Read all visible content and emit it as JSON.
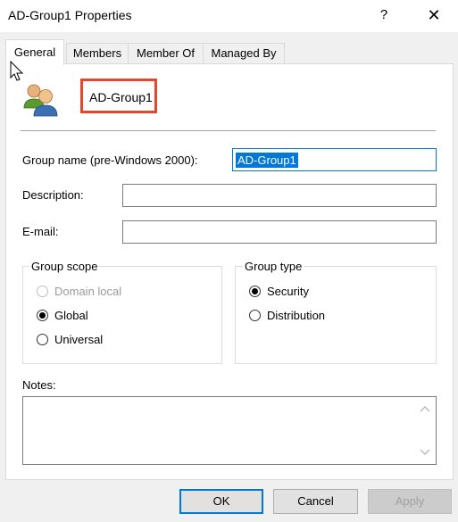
{
  "window": {
    "title": "AD-Group1 Properties",
    "help_glyph": "?",
    "close_glyph": "✕"
  },
  "tabs": [
    {
      "label": "General",
      "active": true
    },
    {
      "label": "Members",
      "active": false
    },
    {
      "label": "Member Of",
      "active": false
    },
    {
      "label": "Managed By",
      "active": false
    }
  ],
  "general": {
    "group_name": "AD-Group1",
    "pre2000_label": "Group name (pre-Windows 2000):",
    "pre2000_value": "AD-Group1",
    "description_label": "Description:",
    "description_value": "",
    "email_label": "E-mail:",
    "email_value": "",
    "group_scope": {
      "legend": "Group scope",
      "options": [
        {
          "label": "Domain local",
          "selected": false,
          "enabled": false
        },
        {
          "label": "Global",
          "selected": true,
          "enabled": true
        },
        {
          "label": "Universal",
          "selected": false,
          "enabled": true
        }
      ]
    },
    "group_type": {
      "legend": "Group type",
      "options": [
        {
          "label": "Security",
          "selected": true,
          "enabled": true
        },
        {
          "label": "Distribution",
          "selected": false,
          "enabled": true
        }
      ]
    },
    "notes_label": "Notes:",
    "notes_value": ""
  },
  "buttons": {
    "ok": "OK",
    "cancel": "Cancel",
    "apply": "Apply"
  },
  "colors": {
    "highlight_border": "#e8452a",
    "focus_accent": "#0078d7"
  }
}
